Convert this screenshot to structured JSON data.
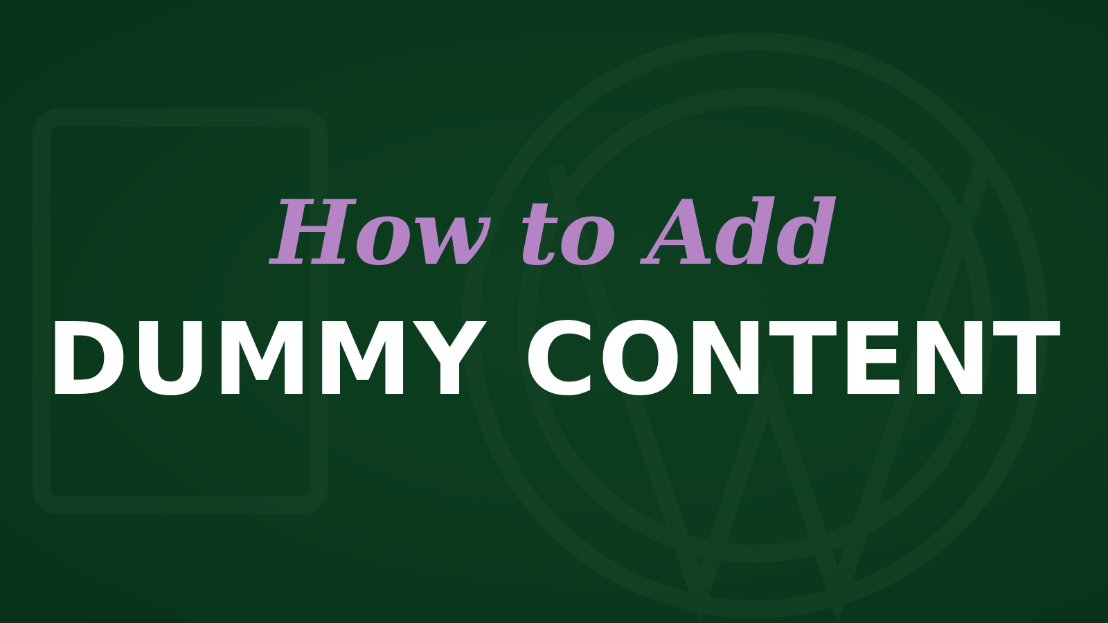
{
  "banner": {
    "subtitle": "How to Add",
    "headline": "DUMMY CONTENT"
  },
  "watermark": {
    "icon": "wordpress-logo-icon"
  },
  "colors": {
    "background": "#0b3a1d",
    "subtitle": "#b584c4",
    "headline": "#ffffff",
    "watermark": "#1a4a2b"
  }
}
